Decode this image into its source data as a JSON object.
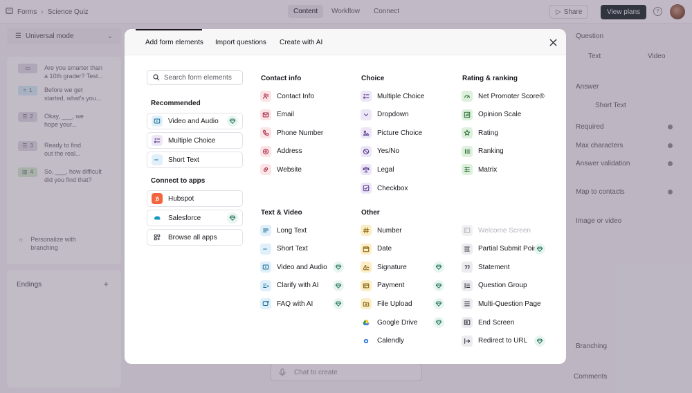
{
  "app": {
    "breadcrumb": [
      "Forms",
      "Science Quiz"
    ],
    "tabs": [
      "Content",
      "Workflow",
      "Connect"
    ],
    "active_tab": "Content",
    "share_label": "Share",
    "view_plans_label": "View plans",
    "mode_label": "Universal mode",
    "questions": [
      {
        "num": "",
        "text1": "Are you smarter than",
        "text2": "a 10th grader? Test...",
        "color": "#dcd9e3"
      },
      {
        "num": "1",
        "text1": "Before we get",
        "text2": "started, what's you...",
        "color": "#cfe6f3"
      },
      {
        "num": "2",
        "text1": "Okay, ___, we",
        "text2": "hope your...",
        "color": "#dcd9e3"
      },
      {
        "num": "3",
        "text1": "Ready to find",
        "text2": "out the real...",
        "color": "#dcd9e3"
      },
      {
        "num": "4",
        "text1": "So, ___, how difficult",
        "text2": "did you find that?",
        "color": "#cfe8cf"
      }
    ],
    "personalize_label": "Personalize with branching",
    "endings_label": "Endings",
    "right": {
      "question_label": "Question",
      "text_tab": "Text",
      "video_tab": "Video",
      "answer_label": "Answer",
      "answer_type": "Short Text",
      "required": "Required",
      "max_characters": "Max characters",
      "answer_validation": "Answer validation",
      "map_to_contacts": "Map to contacts",
      "image_or_video": "Image or video",
      "branching": "Branching",
      "comments": "Comments"
    },
    "chat_placeholder": "Chat to create"
  },
  "modal": {
    "tabs": [
      "Add form elements",
      "Import questions",
      "Create with AI"
    ],
    "search_placeholder": "Search form elements",
    "recommended_heading": "Recommended",
    "recommended": [
      {
        "label": "Video and Audio",
        "icon": "video-icon",
        "bg": "#dff0fa",
        "fg": "#1f6f97",
        "premium": true
      },
      {
        "label": "Multiple Choice",
        "icon": "multiple-choice-icon",
        "bg": "#ece6f7",
        "fg": "#5b3f8f",
        "premium": false
      },
      {
        "label": "Short Text",
        "icon": "short-text-icon",
        "bg": "#dff0fa",
        "fg": "#1f6f97",
        "premium": false
      }
    ],
    "apps_heading": "Connect to apps",
    "apps": [
      {
        "label": "Hubspot",
        "icon": "hubspot-icon",
        "bg": "#f5653d",
        "fg": "#ffffff",
        "premium": false
      },
      {
        "label": "Salesforce",
        "icon": "salesforce-icon",
        "bg": "#ffffff",
        "fg": "#1798c1",
        "premium": true
      },
      {
        "label": "Browse all apps",
        "icon": "apps-grid-icon",
        "bg": "#ffffff",
        "fg": "#3a3640",
        "premium": false
      }
    ],
    "columns": [
      {
        "heading": "Contact info",
        "items": [
          {
            "label": "Contact Info",
            "icon": "contact-card-icon",
            "bg": "#fbe3e6",
            "fg": "#a8324a",
            "premium": false
          },
          {
            "label": "Email",
            "icon": "email-icon",
            "bg": "#fbe3e6",
            "fg": "#a8324a",
            "premium": false
          },
          {
            "label": "Phone Number",
            "icon": "phone-icon",
            "bg": "#fbe3e6",
            "fg": "#a8324a",
            "premium": false
          },
          {
            "label": "Address",
            "icon": "location-icon",
            "bg": "#fbe3e6",
            "fg": "#a8324a",
            "premium": false
          },
          {
            "label": "Website",
            "icon": "link-icon",
            "bg": "#fbe3e6",
            "fg": "#a8324a",
            "premium": false
          }
        ]
      },
      {
        "heading": "Text & Video",
        "items": [
          {
            "label": "Long Text",
            "icon": "long-text-icon",
            "bg": "#dff0fa",
            "fg": "#1f6f97",
            "premium": false
          },
          {
            "label": "Short Text",
            "icon": "short-text-icon",
            "bg": "#dff0fa",
            "fg": "#1f6f97",
            "premium": false
          },
          {
            "label": "Video and Audio",
            "icon": "video-icon",
            "bg": "#dff0fa",
            "fg": "#1f6f97",
            "premium": true
          },
          {
            "label": "Clarify with AI",
            "icon": "clarify-ai-icon",
            "bg": "#dff0fa",
            "fg": "#1f6f97",
            "premium": true
          },
          {
            "label": "FAQ with AI",
            "icon": "faq-ai-icon",
            "bg": "#dff0fa",
            "fg": "#1f6f97",
            "premium": true
          }
        ]
      },
      {
        "heading": "Choice",
        "items": [
          {
            "label": "Multiple Choice",
            "icon": "multiple-choice-icon",
            "bg": "#ece6f7",
            "fg": "#5b3f8f",
            "premium": false
          },
          {
            "label": "Dropdown",
            "icon": "dropdown-icon",
            "bg": "#ece6f7",
            "fg": "#5b3f8f",
            "premium": false
          },
          {
            "label": "Picture Choice",
            "icon": "picture-icon",
            "bg": "#ece6f7",
            "fg": "#5b3f8f",
            "premium": false
          },
          {
            "label": "Yes/No",
            "icon": "yes-no-icon",
            "bg": "#ece6f7",
            "fg": "#5b3f8f",
            "premium": false
          },
          {
            "label": "Legal",
            "icon": "legal-scale-icon",
            "bg": "#ece6f7",
            "fg": "#5b3f8f",
            "premium": false
          },
          {
            "label": "Checkbox",
            "icon": "checkbox-icon",
            "bg": "#ece6f7",
            "fg": "#5b3f8f",
            "premium": false
          }
        ]
      },
      {
        "heading": "Other",
        "items": [
          {
            "label": "Number",
            "icon": "hash-icon",
            "bg": "#fbeec7",
            "fg": "#8a6410",
            "premium": false
          },
          {
            "label": "Date",
            "icon": "calendar-icon",
            "bg": "#fbeec7",
            "fg": "#8a6410",
            "premium": false
          },
          {
            "label": "Signature",
            "icon": "signature-icon",
            "bg": "#fbeec7",
            "fg": "#8a6410",
            "premium": true
          },
          {
            "label": "Payment",
            "icon": "payment-card-icon",
            "bg": "#fbeec7",
            "fg": "#8a6410",
            "premium": true
          },
          {
            "label": "File Upload",
            "icon": "file-upload-icon",
            "bg": "#fbeec7",
            "fg": "#8a6410",
            "premium": true
          },
          {
            "label": "Google Drive",
            "icon": "google-drive-icon",
            "bg": "#ffffff",
            "fg": "#2f8e48",
            "premium": true
          },
          {
            "label": "Calendly",
            "icon": "calendly-icon",
            "bg": "#ffffff",
            "fg": "#1a6ce0",
            "premium": false
          }
        ]
      },
      {
        "heading": "Rating & ranking",
        "items": [
          {
            "label": "Net Promoter Score®",
            "icon": "gauge-icon",
            "bg": "#dcf0dc",
            "fg": "#2f6d36",
            "premium": false
          },
          {
            "label": "Opinion Scale",
            "icon": "scale-bars-icon",
            "bg": "#dcf0dc",
            "fg": "#2f6d36",
            "premium": false
          },
          {
            "label": "Rating",
            "icon": "star-icon",
            "bg": "#dcf0dc",
            "fg": "#2f6d36",
            "premium": false
          },
          {
            "label": "Ranking",
            "icon": "ranking-icon",
            "bg": "#dcf0dc",
            "fg": "#2f6d36",
            "premium": false
          },
          {
            "label": "Matrix",
            "icon": "matrix-icon",
            "bg": "#dcf0dc",
            "fg": "#2f6d36",
            "premium": false
          }
        ]
      },
      {
        "heading": "",
        "items": [
          {
            "label": "Welcome Screen",
            "icon": "welcome-screen-icon",
            "bg": "#f1f0f3",
            "fg": "#b8b4bd",
            "premium": false,
            "disabled": true
          },
          {
            "label": "Partial Submit Point",
            "icon": "partial-submit-icon",
            "bg": "#ecebef",
            "fg": "#3a3640",
            "premium": true
          },
          {
            "label": "Statement",
            "icon": "quote-icon",
            "bg": "#ecebef",
            "fg": "#3a3640",
            "premium": false
          },
          {
            "label": "Question Group",
            "icon": "question-group-icon",
            "bg": "#ecebef",
            "fg": "#3a3640",
            "premium": false
          },
          {
            "label": "Multi-Question Page",
            "icon": "multi-question-icon",
            "bg": "#ecebef",
            "fg": "#3a3640",
            "premium": false
          },
          {
            "label": "End Screen",
            "icon": "end-screen-icon",
            "bg": "#ecebef",
            "fg": "#3a3640",
            "premium": false
          },
          {
            "label": "Redirect to URL",
            "icon": "redirect-icon",
            "bg": "#ecebef",
            "fg": "#3a3640",
            "premium": true
          }
        ]
      }
    ]
  }
}
